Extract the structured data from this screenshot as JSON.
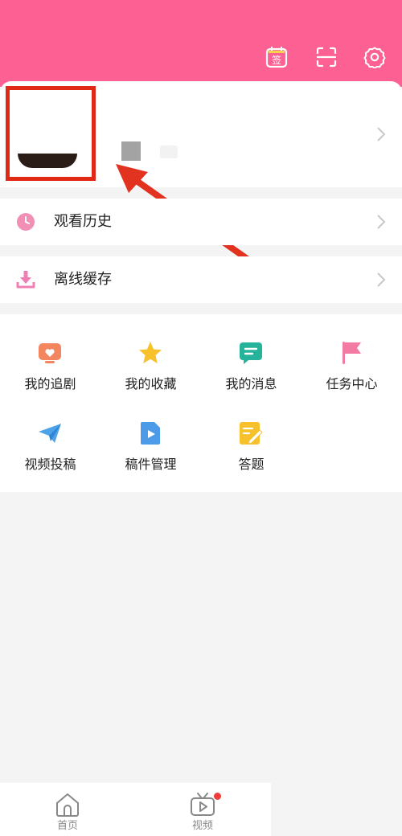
{
  "header": {
    "bg_color": "#fd6193",
    "icons": [
      "sign-in-icon",
      "scan-icon",
      "settings-icon"
    ],
    "sign_in_glyph": "签"
  },
  "profile": {
    "highlight_color": "#e02914"
  },
  "rows": [
    {
      "label": "观看历史",
      "icon": "clock-icon"
    },
    {
      "label": "离线缓存",
      "icon": "download-icon"
    }
  ],
  "grid": [
    {
      "label": "我的追剧",
      "icon": "tv-heart-icon"
    },
    {
      "label": "我的收藏",
      "icon": "star-icon"
    },
    {
      "label": "我的消息",
      "icon": "message-icon"
    },
    {
      "label": "任务中心",
      "icon": "flag-icon"
    },
    {
      "label": "视频投稿",
      "icon": "paper-plane-icon"
    },
    {
      "label": "稿件管理",
      "icon": "video-file-icon"
    },
    {
      "label": "答题",
      "icon": "edit-note-icon"
    }
  ],
  "tabbar": [
    {
      "label": "首页",
      "icon": "home-icon"
    },
    {
      "label": "视频",
      "icon": "tv-play-icon",
      "badge": true
    }
  ]
}
